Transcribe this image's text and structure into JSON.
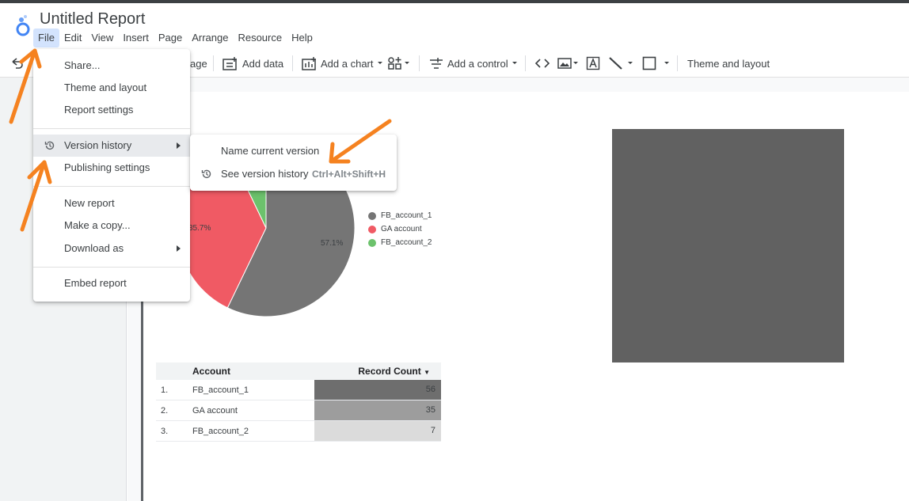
{
  "app": {
    "title": "Untitled Report"
  },
  "menubar": [
    "File",
    "Edit",
    "View",
    "Insert",
    "Page",
    "Arrange",
    "Resource",
    "Help"
  ],
  "toolbar": {
    "page_partial": "age",
    "add_data": "Add data",
    "add_chart": "Add a chart",
    "add_control": "Add a control",
    "theme_layout": "Theme and layout"
  },
  "file_menu": {
    "share": "Share...",
    "theme_layout": "Theme and layout",
    "report_settings": "Report settings",
    "version_history": "Version history",
    "publishing_settings": "Publishing settings",
    "new_report": "New report",
    "make_copy": "Make a copy...",
    "download_as": "Download as",
    "embed_report": "Embed report"
  },
  "version_submenu": {
    "name_current": "Name current version",
    "see_history": "See version history",
    "shortcut": "Ctrl+Alt+Shift+H"
  },
  "chart_data": [
    {
      "type": "pie",
      "series": [
        {
          "name": "FB_account_1",
          "value": 57.1,
          "color": "#757575"
        },
        {
          "name": "GA account",
          "value": 35.7,
          "color": "#f05a64"
        },
        {
          "name": "FB_account_2",
          "value": 7.1,
          "color": "#6cc26c"
        }
      ],
      "slice_labels": [
        "57.1%",
        "35.7%"
      ],
      "legend": "right"
    },
    {
      "type": "table",
      "columns": [
        "Account",
        "Record Count"
      ],
      "rows": [
        {
          "idx": "1.",
          "account": "FB_account_1",
          "count": 56
        },
        {
          "idx": "2.",
          "account": "GA account",
          "count": 35
        },
        {
          "idx": "3.",
          "account": "FB_account_2",
          "count": 7
        }
      ]
    }
  ],
  "colors": {
    "accent": "#f58220",
    "menu_active": "#d3e3fd",
    "box": "#616161"
  }
}
